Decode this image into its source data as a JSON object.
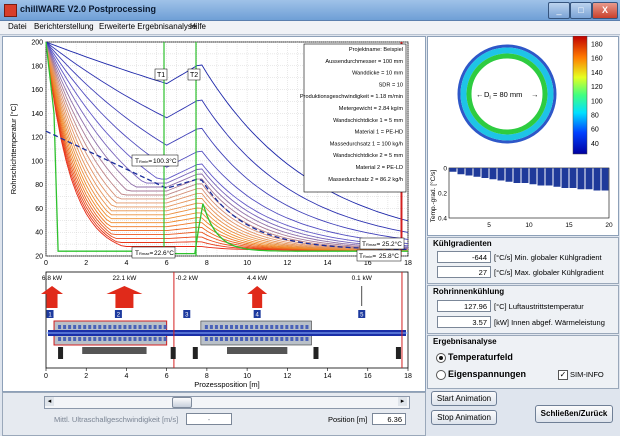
{
  "window": {
    "title": "chillWARE V2.0 Postprocessing",
    "minimize_label": "_",
    "maximize_label": "□",
    "close_label": "X"
  },
  "menu": [
    "Datei",
    "Berichterstellung",
    "Erweiterte Ergebnisanalyse",
    "Hilfe"
  ],
  "main_chart": {
    "ylabel": "Rohrschichttemperatur [°C]",
    "y_ticks": [
      "200",
      "180",
      "160",
      "140",
      "120",
      "100",
      "80",
      "60",
      "40",
      "20"
    ],
    "x_ticks": [
      "0",
      "2",
      "4",
      "6",
      "8",
      "10",
      "12",
      "14",
      "16",
      "18"
    ],
    "markers": [
      "T1",
      "T2"
    ],
    "annotations": {
      "tmin_mid": "100.3°C",
      "tmax_left": "22.6°C",
      "tmax_right": "25.2°C",
      "tmin_right": "25.8°C"
    },
    "info_box": [
      "Projektname: Beispiel",
      "Aussendurchmesser = 100 mm",
      "Wanddicke = 10 mm",
      "SDR = 10",
      "Produktionsgeschwindigkeit = 1.18 m/min",
      "Metergewicht = 2.84 kg/m",
      "Wandschichtdicke 1 = 5 mm",
      "Material 1 = PE-HD",
      "Massedurchsatz 1 = 100 kg/h",
      "Wandschichtdicke 2 = 5 mm",
      "Material 2 = PE-LD",
      "Massedurchsatz 2 = 86.2 kg/h"
    ]
  },
  "line_chart": {
    "x_ticks": [
      "0",
      "2",
      "4",
      "6",
      "8",
      "10",
      "12",
      "14",
      "16",
      "18"
    ],
    "xlabel": "Prozessposition [m]",
    "power_labels": [
      "6.8 kW",
      "22.1 kW",
      "-0.2 kW",
      "4.4 kW",
      "0.1 kW"
    ],
    "zone_numbers": [
      "1",
      "2",
      "3",
      "4",
      "5"
    ]
  },
  "pipe_section": {
    "diameter_label": "D",
    "diameter_sub": "i",
    "diameter_value": "= 80 mm"
  },
  "colorbar": {
    "ticks": [
      "180",
      "160",
      "140",
      "120",
      "100",
      "80",
      "60",
      "40"
    ]
  },
  "grad_chart": {
    "ylabel": "Temp.-grad. [°C/s]",
    "y_ticks": [
      "0",
      "0.2",
      "0.4"
    ],
    "x_ticks": [
      "5",
      "10",
      "15",
      "20"
    ],
    "values": [
      0.03,
      0.05,
      0.06,
      0.07,
      0.08,
      0.09,
      0.1,
      0.11,
      0.12,
      0.12,
      0.13,
      0.14,
      0.14,
      0.15,
      0.16,
      0.16,
      0.17,
      0.17,
      0.18,
      0.18
    ]
  },
  "kuehlgradienten": {
    "title": "Kühlgradienten",
    "min_value": "-644",
    "min_label": "[°C/s] Min. globaler Kühlgradient",
    "max_value": "27",
    "max_label": "[°C/s] Max. globaler Kühlgradient"
  },
  "rohrinnenkuehlung": {
    "title": "Rohrinnenkühlung",
    "temp_value": "127.96",
    "temp_label": "[°C] Luftaustrittstemperatur",
    "power_value": "3.57",
    "power_label": "[kW] Innen abgef. Wärmeleistung"
  },
  "ergebnisanalyse": {
    "title": "Ergebnisanalyse",
    "option1": "Temperaturfeld",
    "option2": "Eigenspannungen",
    "checkbox": "SIM-INFO"
  },
  "bottom": {
    "ultrasound_label": "Mittl. Ultraschallgeschwindigkeit [m/s]",
    "ultrasound_value": "-",
    "position_label": "Position [m]",
    "position_value": "6.36",
    "slider_fraction": 0.35
  },
  "buttons": {
    "start": "Start Animation",
    "stop": "Stop Animation",
    "close": "Schließen/Zurück"
  },
  "colors": {
    "hot": "#d42020",
    "cold": "#1a3fa8",
    "accent_green": "#2ec22e"
  }
}
